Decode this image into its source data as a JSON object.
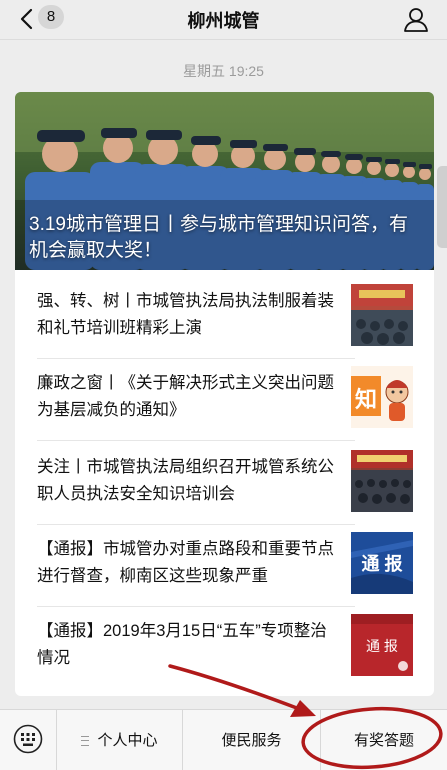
{
  "header": {
    "back_icon": "chevron-left-icon",
    "unread_count": "8",
    "title": "柳州城管",
    "profile_icon": "person-icon"
  },
  "timestamp": "星期五 19:25",
  "article_card": {
    "hero": {
      "title": "3.19城市管理日丨参与城市管理知识问答，有机会赢取大奖！"
    },
    "items": [
      {
        "title": "强、转、树丨市城管执法局执法制服着装和礼节培训班精彩上演",
        "thumb": "meeting-photo"
      },
      {
        "title": "廉政之窗丨《关于解决形式主义突出问题为基层减负的通知》",
        "thumb": "cartoon-notice",
        "thumb_text": "知"
      },
      {
        "title": "关注丨市城管执法局组织召开城管系统公职人员执法安全知识培训会",
        "thumb": "conference-photo"
      },
      {
        "title": "【通报】市城管办对重点路段和重要节点进行督查，柳南区这些现象严重",
        "thumb": "notice-banner-blue",
        "thumb_text": "通 报"
      },
      {
        "title": "【通报】2019年3月15日“五车”专项整治情况",
        "thumb": "notice-banner-red",
        "thumb_text": "通 报"
      }
    ]
  },
  "bottom_menu": {
    "keyboard_icon": "keyboard-icon",
    "items": [
      "个人中心",
      "便民服务",
      "有奖答题"
    ]
  },
  "colors": {
    "annotation": "#b01a1a",
    "hero_uniform": "#3e6fb5",
    "notice_blue": "#1e4d9a",
    "notice_red": "#b8262b"
  }
}
